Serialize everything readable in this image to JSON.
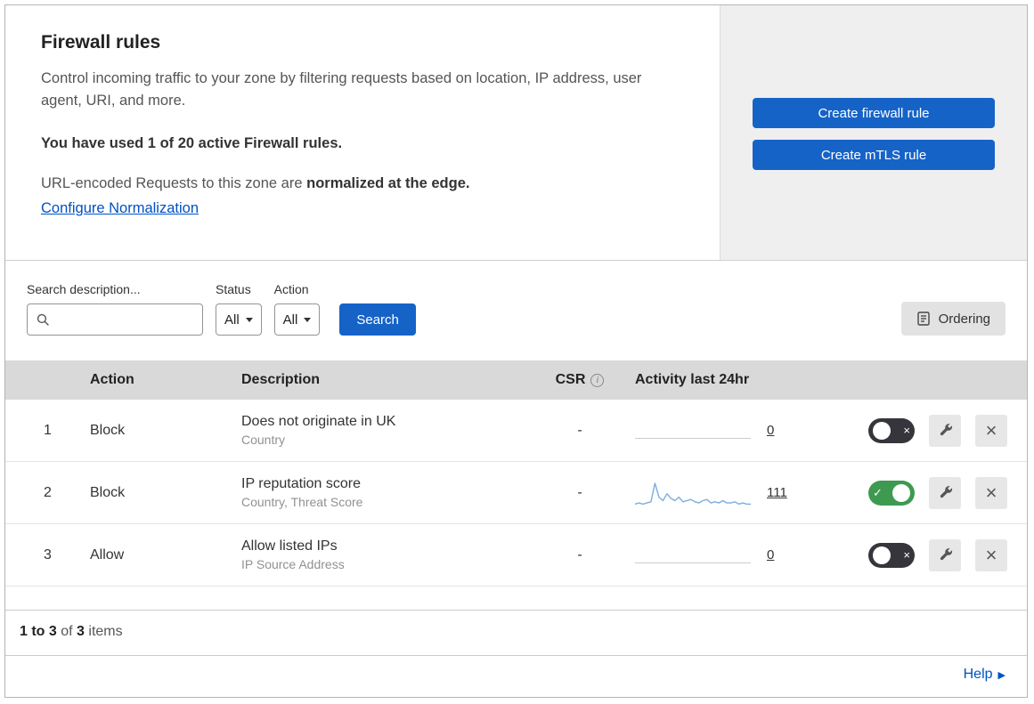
{
  "header": {
    "title": "Firewall rules",
    "description": "Control incoming traffic to your zone by filtering requests based on location, IP address, user agent, URI, and more.",
    "usage": "You have used 1 of 20 active Firewall rules.",
    "normalization_prefix": "URL-encoded Requests to this zone are",
    "normalization_bold": "normalized at the edge.",
    "configure_link": "Configure Normalization",
    "create_firewall_button": "Create firewall rule",
    "create_mtls_button": "Create mTLS rule"
  },
  "filters": {
    "search_label": "Search description...",
    "status_label": "Status",
    "status_value": "All",
    "action_label": "Action",
    "action_value": "All",
    "search_button": "Search",
    "ordering_button": "Ordering"
  },
  "table": {
    "headers": {
      "action": "Action",
      "description": "Description",
      "csr": "CSR",
      "activity": "Activity last 24hr"
    },
    "rows": [
      {
        "index": "1",
        "action": "Block",
        "description": "Does not originate in UK",
        "criteria": "Country",
        "csr": "-",
        "activity_count": "0",
        "enabled": false
      },
      {
        "index": "2",
        "action": "Block",
        "description": "IP reputation score",
        "criteria": "Country, Threat Score",
        "csr": "-",
        "activity_count": "111",
        "enabled": true,
        "sparkline": [
          2,
          3,
          2,
          3,
          4,
          20,
          8,
          5,
          11,
          7,
          5,
          8,
          4,
          5,
          6,
          4,
          3,
          5,
          6,
          3,
          4,
          3,
          5,
          3,
          3,
          4,
          2,
          3,
          2,
          2
        ]
      },
      {
        "index": "3",
        "action": "Allow",
        "description": "Allow listed IPs",
        "criteria": "IP Source Address",
        "csr": "-",
        "activity_count": "0",
        "enabled": false
      }
    ]
  },
  "footer": {
    "range": "1 to 3",
    "of_text": "of",
    "total": "3",
    "items_text": "items"
  },
  "help": {
    "label": "Help"
  },
  "colors": {
    "primary_blue": "#1663c7",
    "link_blue": "#0051c3",
    "toggle_on_green": "#3d9a50",
    "toggle_off_dark": "#36353b",
    "sparkline_blue": "#7aaede"
  }
}
